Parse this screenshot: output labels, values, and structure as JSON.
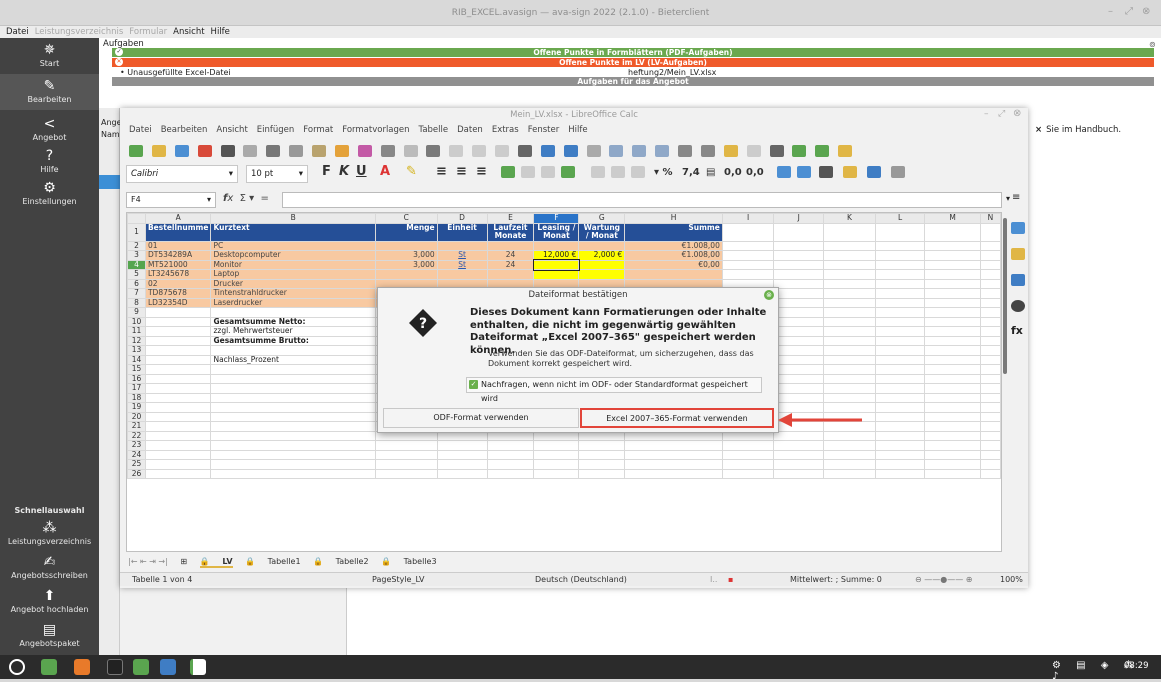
{
  "app": {
    "title": "RIB_EXCEL.avasign — ava-sign 2022 (2.1.0) - Bieterclient",
    "menu": [
      "Datei",
      "Leistungsverzeichnis",
      "Formular",
      "Ansicht",
      "Hilfe"
    ]
  },
  "sidebar": {
    "items": [
      {
        "label": "Start",
        "icon": "settings-star-icon"
      },
      {
        "label": "Bearbeiten",
        "icon": "pencil-icon"
      },
      {
        "label": "Angebot",
        "icon": "share-icon"
      },
      {
        "label": "Hilfe",
        "icon": "help-icon"
      },
      {
        "label": "Einstellungen",
        "icon": "gear-icon"
      }
    ],
    "quick_title": "Schnellauswahl",
    "quick_items": [
      {
        "label": "Leistungsverzeichnis",
        "icon": "tree-icon"
      },
      {
        "label": "Angebotsschreiben",
        "icon": "edit-icon"
      },
      {
        "label": "Angebot hochladen",
        "icon": "upload-icon"
      },
      {
        "label": "Angebotspaket",
        "icon": "package-icon"
      }
    ]
  },
  "tasks": {
    "label": "Aufgaben",
    "green": "Offene Punkte in Formblättern (PDF-Aufgaben)",
    "red": "Offene Punkte im LV (LV-Aufgaben)",
    "unaus_label": "• Unausgefüllte Excel-Datei",
    "unaus_file": "heftung2/Mein_LV.xlsx",
    "grey": "Aufgaben für das Angebot",
    "right_note": "Sie im Handbuch.",
    "left_partial_1": "Angeb",
    "left_partial_2": "Name"
  },
  "calc": {
    "title": "Mein_LV.xlsx - LibreOffice Calc",
    "menu": [
      "Datei",
      "Bearbeiten",
      "Ansicht",
      "Einfügen",
      "Format",
      "Formatvorlagen",
      "Tabelle",
      "Daten",
      "Extras",
      "Fenster",
      "Hilfe"
    ],
    "font_name": "Calibri",
    "font_size": "10 pt",
    "cell_ref": "F4",
    "columns": [
      "A",
      "B",
      "C",
      "D",
      "E",
      "F",
      "G",
      "H",
      "I",
      "J",
      "K",
      "L",
      "M",
      "N"
    ],
    "header": {
      "a": "Bestellnumme",
      "b": "Kurztext",
      "c": "Menge",
      "d": "Einheit",
      "e": "Laufzeit Monate",
      "f": "Leasing / Monat",
      "g": "Wartung / Monat",
      "h": "Summe"
    },
    "rows": [
      {
        "n": "2",
        "a": "01",
        "b": "PC",
        "c": "",
        "d": "",
        "e": "",
        "f": "",
        "g": "",
        "h": "€1.008,00"
      },
      {
        "n": "3",
        "a": "DT534289A",
        "b": "Desktopcomputer",
        "c": "3,000",
        "d": "St",
        "e": "24",
        "f": "12,000 €",
        "g": "2,000 €",
        "h": "€1.008,00"
      },
      {
        "n": "4",
        "a": "MT521000",
        "b": "Monitor",
        "c": "3,000",
        "d": "St",
        "e": "24",
        "f": "",
        "g": "",
        "h": "€0,00"
      },
      {
        "n": "5",
        "a": "LT3245678",
        "b": "Laptop",
        "c": "",
        "d": "",
        "e": "",
        "f": "",
        "g": "",
        "h": ""
      },
      {
        "n": "6",
        "a": "02",
        "b": "Drucker",
        "c": "",
        "d": "",
        "e": "",
        "f": "",
        "g": "",
        "h": ""
      },
      {
        "n": "7",
        "a": "TD875678",
        "b": "Tintenstrahldrucker",
        "c": "",
        "d": "",
        "e": "",
        "f": "",
        "g": "",
        "h": ""
      },
      {
        "n": "8",
        "a": "LD32354D",
        "b": "Laserdrucker",
        "c": "",
        "d": "",
        "e": "",
        "f": "",
        "g": "",
        "h": ""
      }
    ],
    "summary": [
      {
        "n": "9",
        "b": ""
      },
      {
        "n": "10",
        "b": "Gesamtsumme Netto:"
      },
      {
        "n": "11",
        "b": "zzgl. Mehrwertsteuer"
      },
      {
        "n": "12",
        "b": "Gesamtsumme Brutto:"
      },
      {
        "n": "13",
        "b": ""
      },
      {
        "n": "14",
        "b": "Nachlass_Prozent"
      }
    ],
    "empty_rows": [
      "15",
      "16",
      "17",
      "18",
      "19",
      "20",
      "21",
      "22",
      "23",
      "24",
      "25",
      "26"
    ],
    "sheet_tabs": [
      "LV",
      "Tabelle1",
      "Tabelle2",
      "Tabelle3"
    ],
    "status": {
      "sheet": "Tabelle 1 von 4",
      "style": "PageStyle_LV",
      "lang": "Deutsch (Deutschland)",
      "sum": "Mittelwert: ; Summe: 0",
      "zoom": "100%"
    }
  },
  "dialog": {
    "title": "Dateiformat bestätigen",
    "heading": "Dieses Dokument kann Formatierungen oder Inhalte enthalten, die nicht im gegenwärtig gewählten Dateiformat „Excel 2007–365\" gespeichert werden können.",
    "body": "Verwenden Sie das ODF-Dateiformat, um sicherzugehen, dass das Dokument korrekt gespeichert wird.",
    "checkbox": "Nachfragen, wenn nicht im ODF- oder Standardformat gespeichert wird",
    "btn_odf": "ODF-Format verwenden",
    "btn_excel": "Excel 2007–365-Format verwenden"
  },
  "taskbar": {
    "clock": "08:29"
  }
}
